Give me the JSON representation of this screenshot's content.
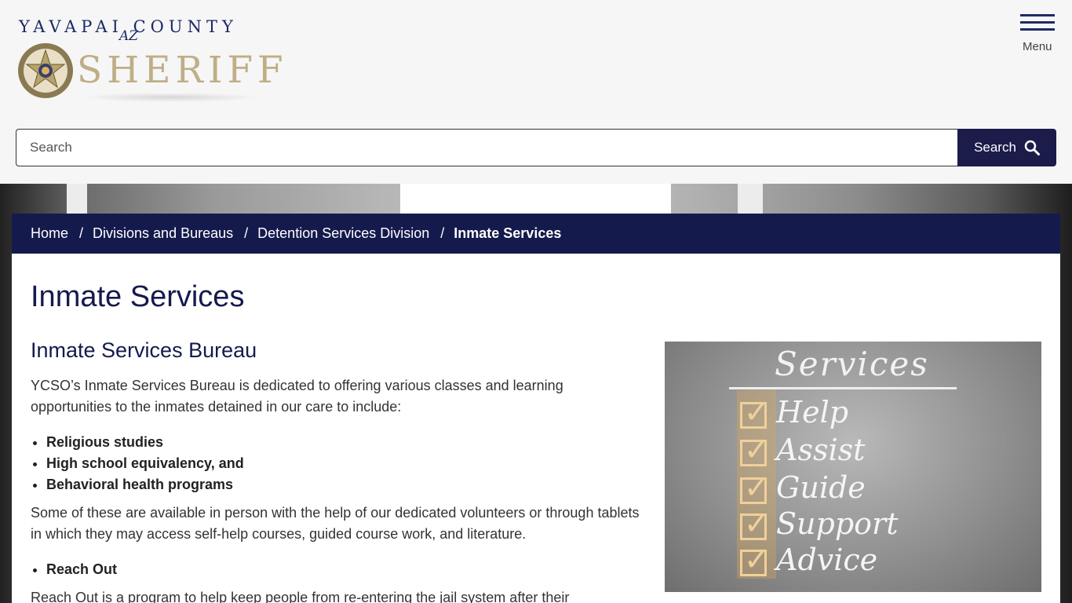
{
  "header": {
    "logo": {
      "top_text": "YAVAPAI COUNTY",
      "az_text": "AZ",
      "main_text": "SHERIFF",
      "badge_text": "YAVAPAI COUNTY SHERIFF'S OFFICE DEPUTY SHERIFF ARIZONA"
    },
    "menu_label": "Menu",
    "search": {
      "placeholder": "Search",
      "button_label": "Search"
    }
  },
  "breadcrumb": {
    "items": [
      {
        "label": "Home"
      },
      {
        "label": "Divisions and Bureaus"
      },
      {
        "label": "Detention Services Division"
      }
    ],
    "separator": "/",
    "current": "Inmate Services"
  },
  "main": {
    "title": "Inmate Services",
    "section_title": "Inmate Services Bureau",
    "intro": "YCSO’s Inmate Services Bureau is dedicated to offering various classes and learning opportunities to the inmates detained in our care to include:",
    "list1": [
      "Religious studies",
      "High school equivalency, and",
      "Behavioral health programs"
    ],
    "para2": "Some of these are available in person with the help of our dedicated volunteers or through tablets in which they may access self-help courses, guided course work, and literature.",
    "list2": [
      "Reach Out"
    ],
    "para3": "Reach Out is a program to help keep people from re-entering the jail system after their"
  },
  "image": {
    "title": "Services",
    "items": [
      "Help",
      "Assist",
      "Guide",
      "Support",
      "Advice"
    ]
  },
  "colors": {
    "navy": "#151a4d",
    "gold": "#bfae86",
    "search_button": "#1b1c4a"
  }
}
